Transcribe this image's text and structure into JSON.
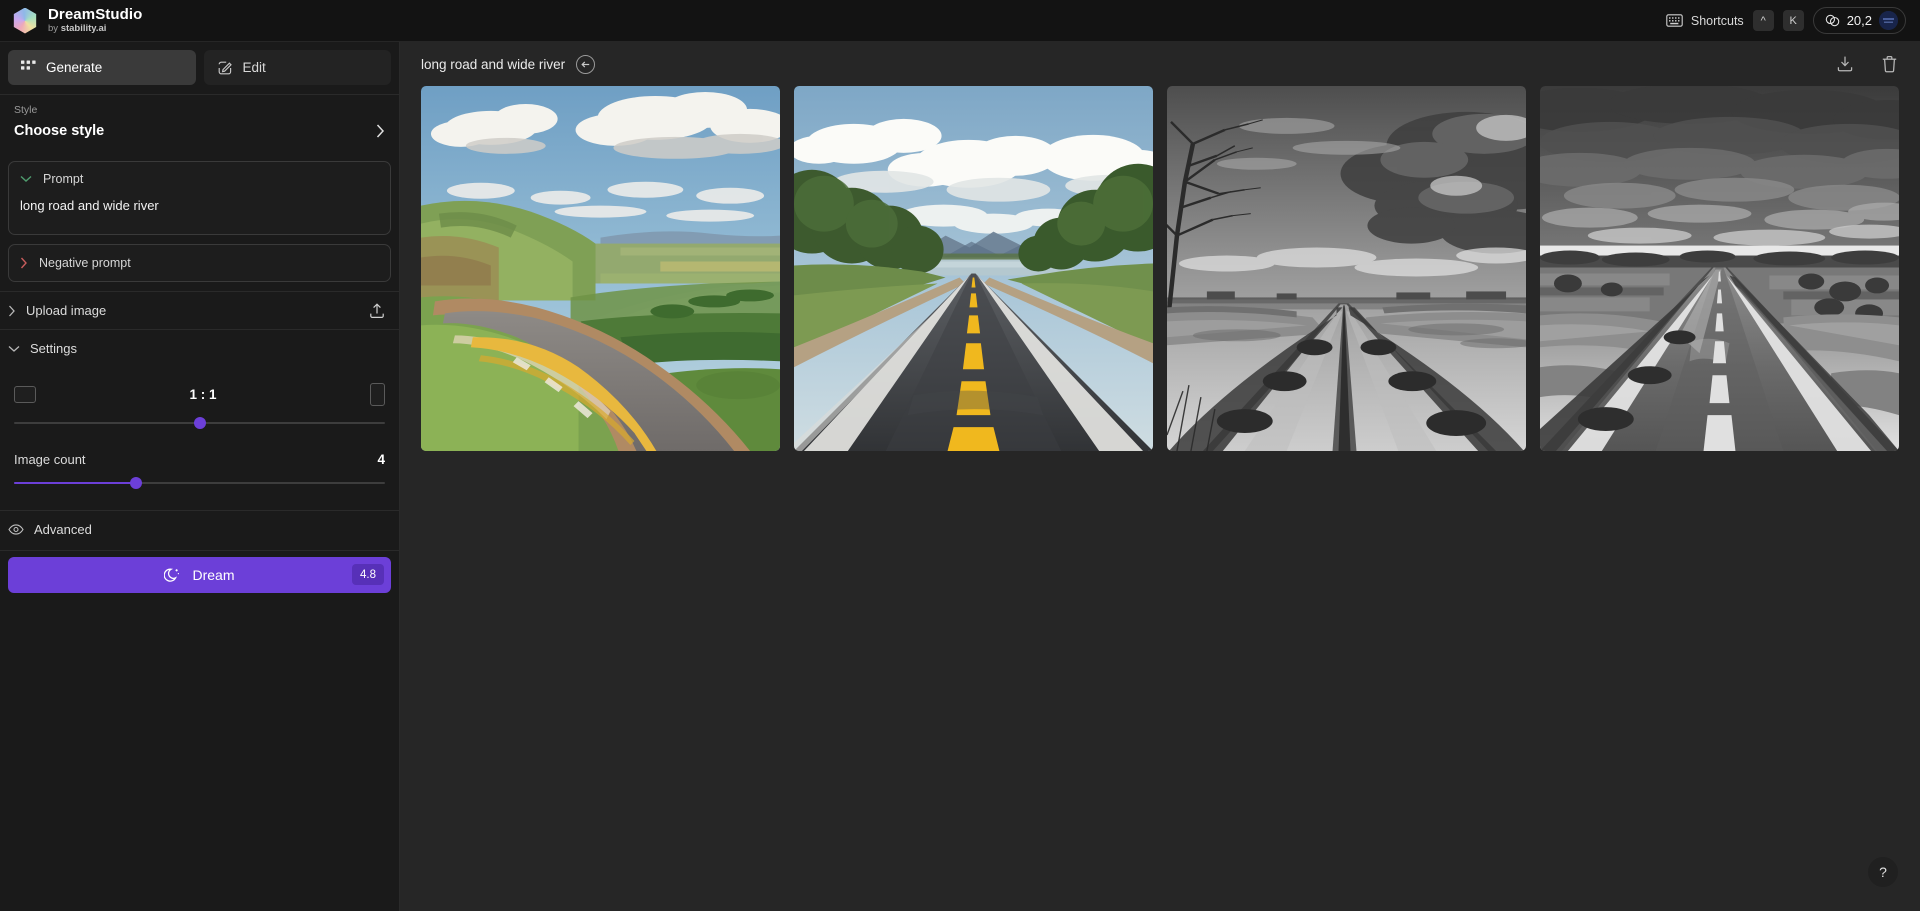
{
  "topbar": {
    "brand_title": "DreamStudio",
    "brand_by": "by",
    "brand_company": "stability.ai",
    "shortcuts_label": "Shortcuts",
    "kbd_modifier": "^",
    "kbd_key": "K",
    "credits_value": "20,2",
    "icons": {
      "keyboard": "keyboard-icon",
      "coin": "coin-icon",
      "logo": "dreamstudio-logo-icon"
    }
  },
  "sidebar": {
    "tabs": [
      {
        "label": "Generate",
        "icon": "grid-icon",
        "active": true
      },
      {
        "label": "Edit",
        "icon": "pencil-square-icon",
        "active": false
      }
    ],
    "style": {
      "label": "Style",
      "value": "Choose style",
      "chevron": "chevron-right-icon"
    },
    "prompt": {
      "title": "Prompt",
      "value": "long road and wide river",
      "chevron": "chevron-down-icon",
      "chevron_color": "#4f9c6e"
    },
    "negative_prompt": {
      "title": "Negative prompt",
      "chevron": "chevron-right-icon",
      "chevron_color": "#c75c5c"
    },
    "upload_image": {
      "label": "Upload image",
      "chevron": "chevron-right-icon",
      "action_icon": "upload-icon"
    },
    "settings": {
      "label": "Settings",
      "chevron": "chevron-down-icon",
      "aspect_ratio": {
        "value": "1 : 1",
        "left_icon": "landscape-frame-icon",
        "right_icon": "portrait-frame-icon",
        "slider_percent": 50
      },
      "image_count": {
        "label": "Image count",
        "value": "4",
        "slider_percent": 33
      }
    },
    "advanced": {
      "label": "Advanced",
      "icon": "eye-icon"
    },
    "dream": {
      "label": "Dream",
      "cost": "4.8",
      "icon": "moon-stars-icon",
      "accent": "#6c3fd8"
    }
  },
  "main": {
    "title": "long road and wide river",
    "back_icon": "arrow-left-circle-icon",
    "download_icon": "download-icon",
    "delete_icon": "trash-icon",
    "help_label": "?",
    "results": [
      {
        "alt": "painted landscape with winding road, green hills and blue river under cumulus clouds",
        "variant": "color-hills-river"
      },
      {
        "alt": "photoreal straight asphalt road with yellow center line, trees and lake with mountains",
        "variant": "color-road-lake"
      },
      {
        "alt": "black and white dirt road between flooded fields with bare tree",
        "variant": "bw-dirt-road"
      },
      {
        "alt": "black and white highway causeway through flooded fields with dramatic clouds",
        "variant": "bw-causeway"
      }
    ]
  }
}
